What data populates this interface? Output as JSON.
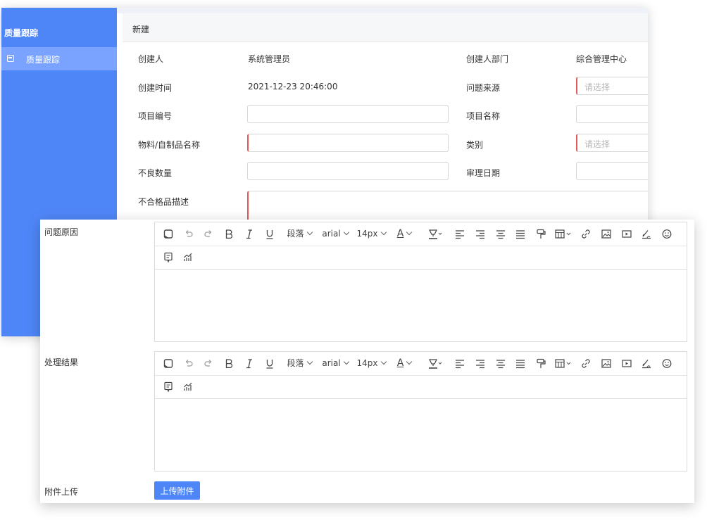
{
  "sidebar": {
    "title": "质量跟踪",
    "items": [
      {
        "label": "质量跟踪"
      }
    ]
  },
  "header": {
    "title": "新建"
  },
  "form": {
    "creator_label": "创建人",
    "creator_value": "系统管理员",
    "dept_label": "创建人部门",
    "dept_value": "综合管理中心",
    "created_time_label": "创建时间",
    "created_time_value": "2021-12-23 20:46:00",
    "source_label": "问题来源",
    "source_placeholder": "请选择",
    "project_no_label": "项目编号",
    "project_name_label": "项目名称",
    "material_label": "物料/自制品名称",
    "category_label": "类别",
    "category_placeholder": "请选择",
    "defect_qty_label": "不良数量",
    "review_date_label": "审理日期",
    "nonconform_desc_label": "不合格品描述",
    "cause_label": "问题原因",
    "result_label": "处理结果",
    "attach_label": "附件上传",
    "upload_button": "上传附件"
  },
  "toolbar": {
    "paragraph": "段落",
    "font": "arial",
    "size": "14px",
    "font_color_letter": "A"
  },
  "icons": [
    "clear-icon",
    "undo-icon",
    "redo-icon",
    "bold-icon",
    "italic-icon",
    "underline-icon",
    "font-color-icon",
    "highlight-icon",
    "align-left-icon",
    "align-right-icon",
    "align-center-icon",
    "justify-icon",
    "format-painter-icon",
    "table-icon",
    "link-icon",
    "image-icon",
    "video-icon",
    "signature-icon",
    "emoji-icon",
    "note-icon",
    "chart-icon"
  ],
  "colors": {
    "sidebar": "#4f86f7",
    "sidebar_active": "#79a3ff",
    "primary_button": "#4f86f7",
    "required_marker": "#e45858"
  }
}
